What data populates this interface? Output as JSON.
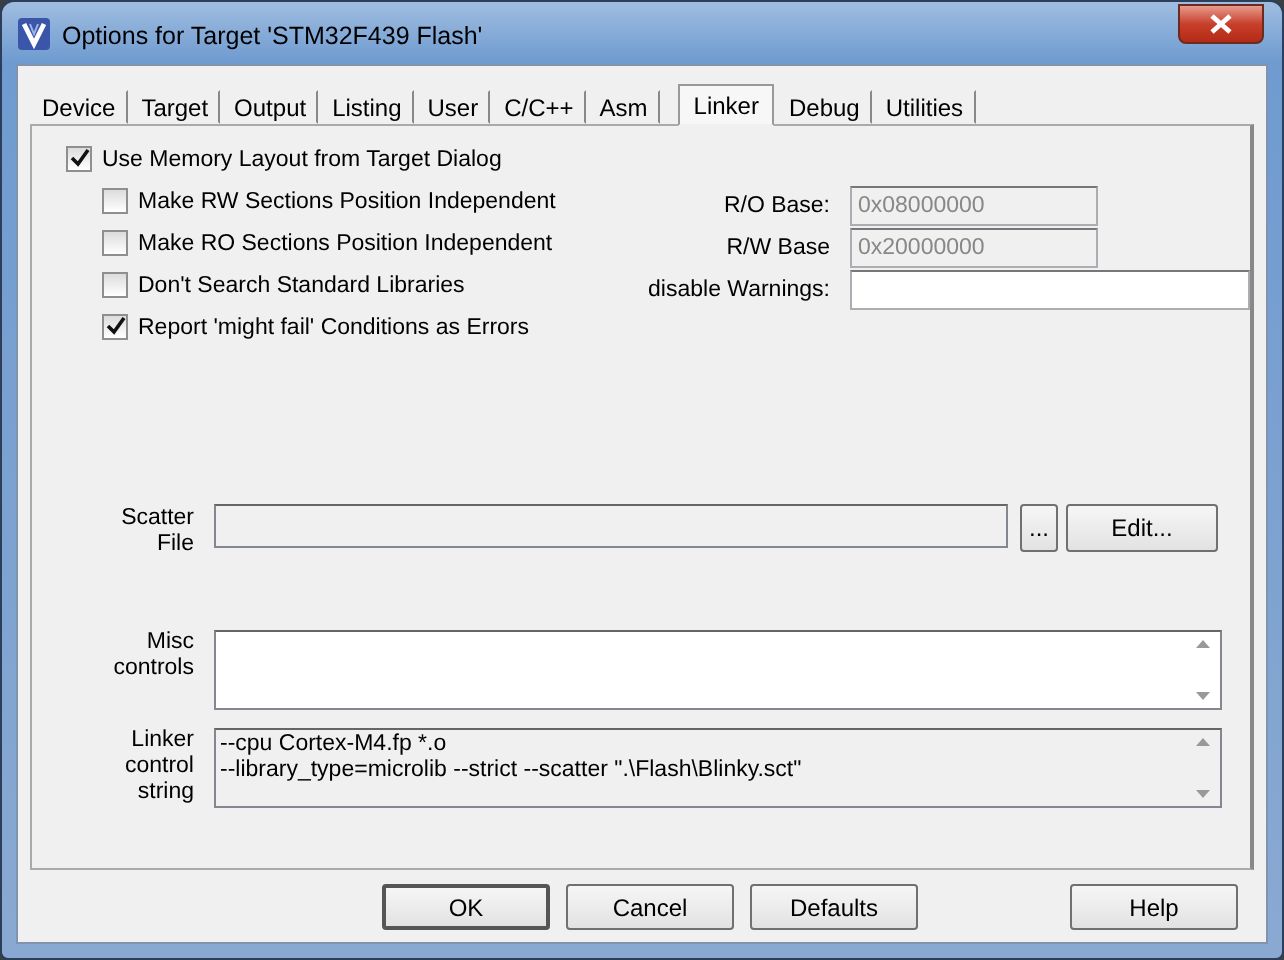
{
  "window": {
    "title": "Options for Target 'STM32F439 Flash'"
  },
  "tabs": [
    {
      "label": "Device",
      "selected": false
    },
    {
      "label": "Target",
      "selected": false
    },
    {
      "label": "Output",
      "selected": false
    },
    {
      "label": "Listing",
      "selected": false
    },
    {
      "label": "User",
      "selected": false
    },
    {
      "label": "C/C++",
      "selected": false
    },
    {
      "label": "Asm",
      "selected": false
    },
    {
      "label": "Linker",
      "selected": true
    },
    {
      "label": "Debug",
      "selected": false
    },
    {
      "label": "Utilities",
      "selected": false
    }
  ],
  "memory_layout": {
    "label": "Use Memory Layout from Target Dialog",
    "checked": true
  },
  "options": [
    {
      "label": "Make RW Sections Position Independent",
      "checked": false
    },
    {
      "label": "Make RO Sections Position Independent",
      "checked": false
    },
    {
      "label": "Don't Search Standard Libraries",
      "checked": false
    },
    {
      "label": "Report 'might fail' Conditions as Errors",
      "checked": true
    }
  ],
  "fields": [
    {
      "label": "R/O Base:",
      "value": "0x08000000",
      "disabled": true,
      "kind": "short"
    },
    {
      "label": "R/W Base",
      "value": "0x20000000",
      "disabled": true,
      "kind": "short"
    },
    {
      "label": "disable Warnings:",
      "disabled": false,
      "kind": "long"
    }
  ],
  "scatter_file": {
    "label": "Scatter File",
    "disabled": true,
    "browse": "...",
    "edit": "Edit..."
  },
  "misc_controls": {
    "label": "Misc controls",
    "disabled": false
  },
  "linker_control_string": {
    "label": "Linker control string",
    "disabled": true,
    "lines": [
      "--cpu Cortex-M4.fp *.o",
      "--library_type=microlib --strict --scatter \".\\Flash\\Blinky.sct\""
    ]
  },
  "buttons": [
    {
      "label": "OK",
      "default": true
    },
    {
      "label": "Cancel",
      "default": false
    },
    {
      "label": "Defaults",
      "default": false
    }
  ],
  "help_button": {
    "label": "Help"
  }
}
